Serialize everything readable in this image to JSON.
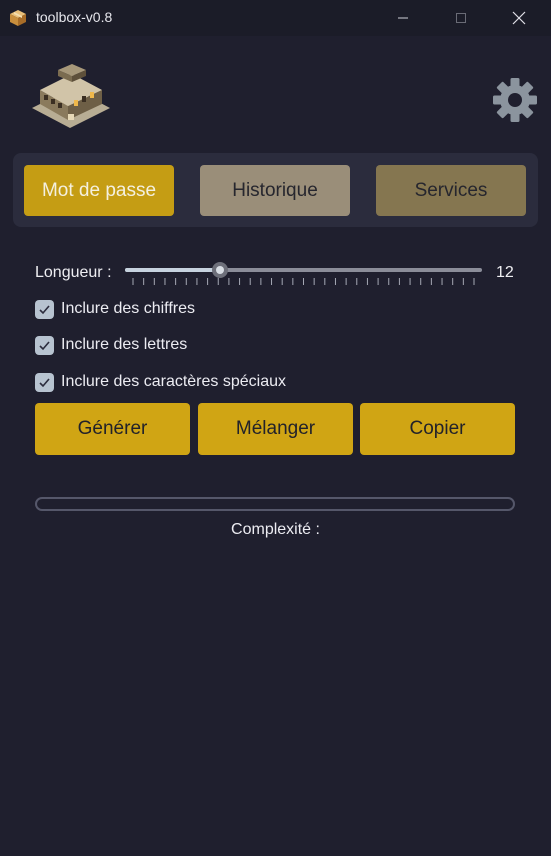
{
  "window": {
    "title": "toolbox-v0.8",
    "icon": "package-icon",
    "controls": [
      "minimize",
      "maximize",
      "close"
    ]
  },
  "header": {
    "logo": "building-logo",
    "settings_icon": "gear-icon"
  },
  "tabs": [
    {
      "label": "Mot de passe",
      "active": true
    },
    {
      "label": "Historique",
      "active": false
    },
    {
      "label": "Services",
      "active": false
    }
  ],
  "length": {
    "label": "Longueur :",
    "value": "12",
    "fraction": 0.25
  },
  "options": [
    {
      "label": "Inclure des chiffres",
      "checked": true
    },
    {
      "label": "Inclure des lettres",
      "checked": true
    },
    {
      "label": "Inclure des caractères spéciaux",
      "checked": true
    }
  ],
  "actions": {
    "generate": "Générer",
    "shuffle": "Mélanger",
    "copy": "Copier"
  },
  "strength": {
    "label": "Complexité :",
    "fraction": 0
  },
  "colors": {
    "background": "#1f1f2e",
    "accent": "#d0a514",
    "tab_inactive_1": "#9a8e79",
    "tab_inactive_2": "#857650"
  }
}
